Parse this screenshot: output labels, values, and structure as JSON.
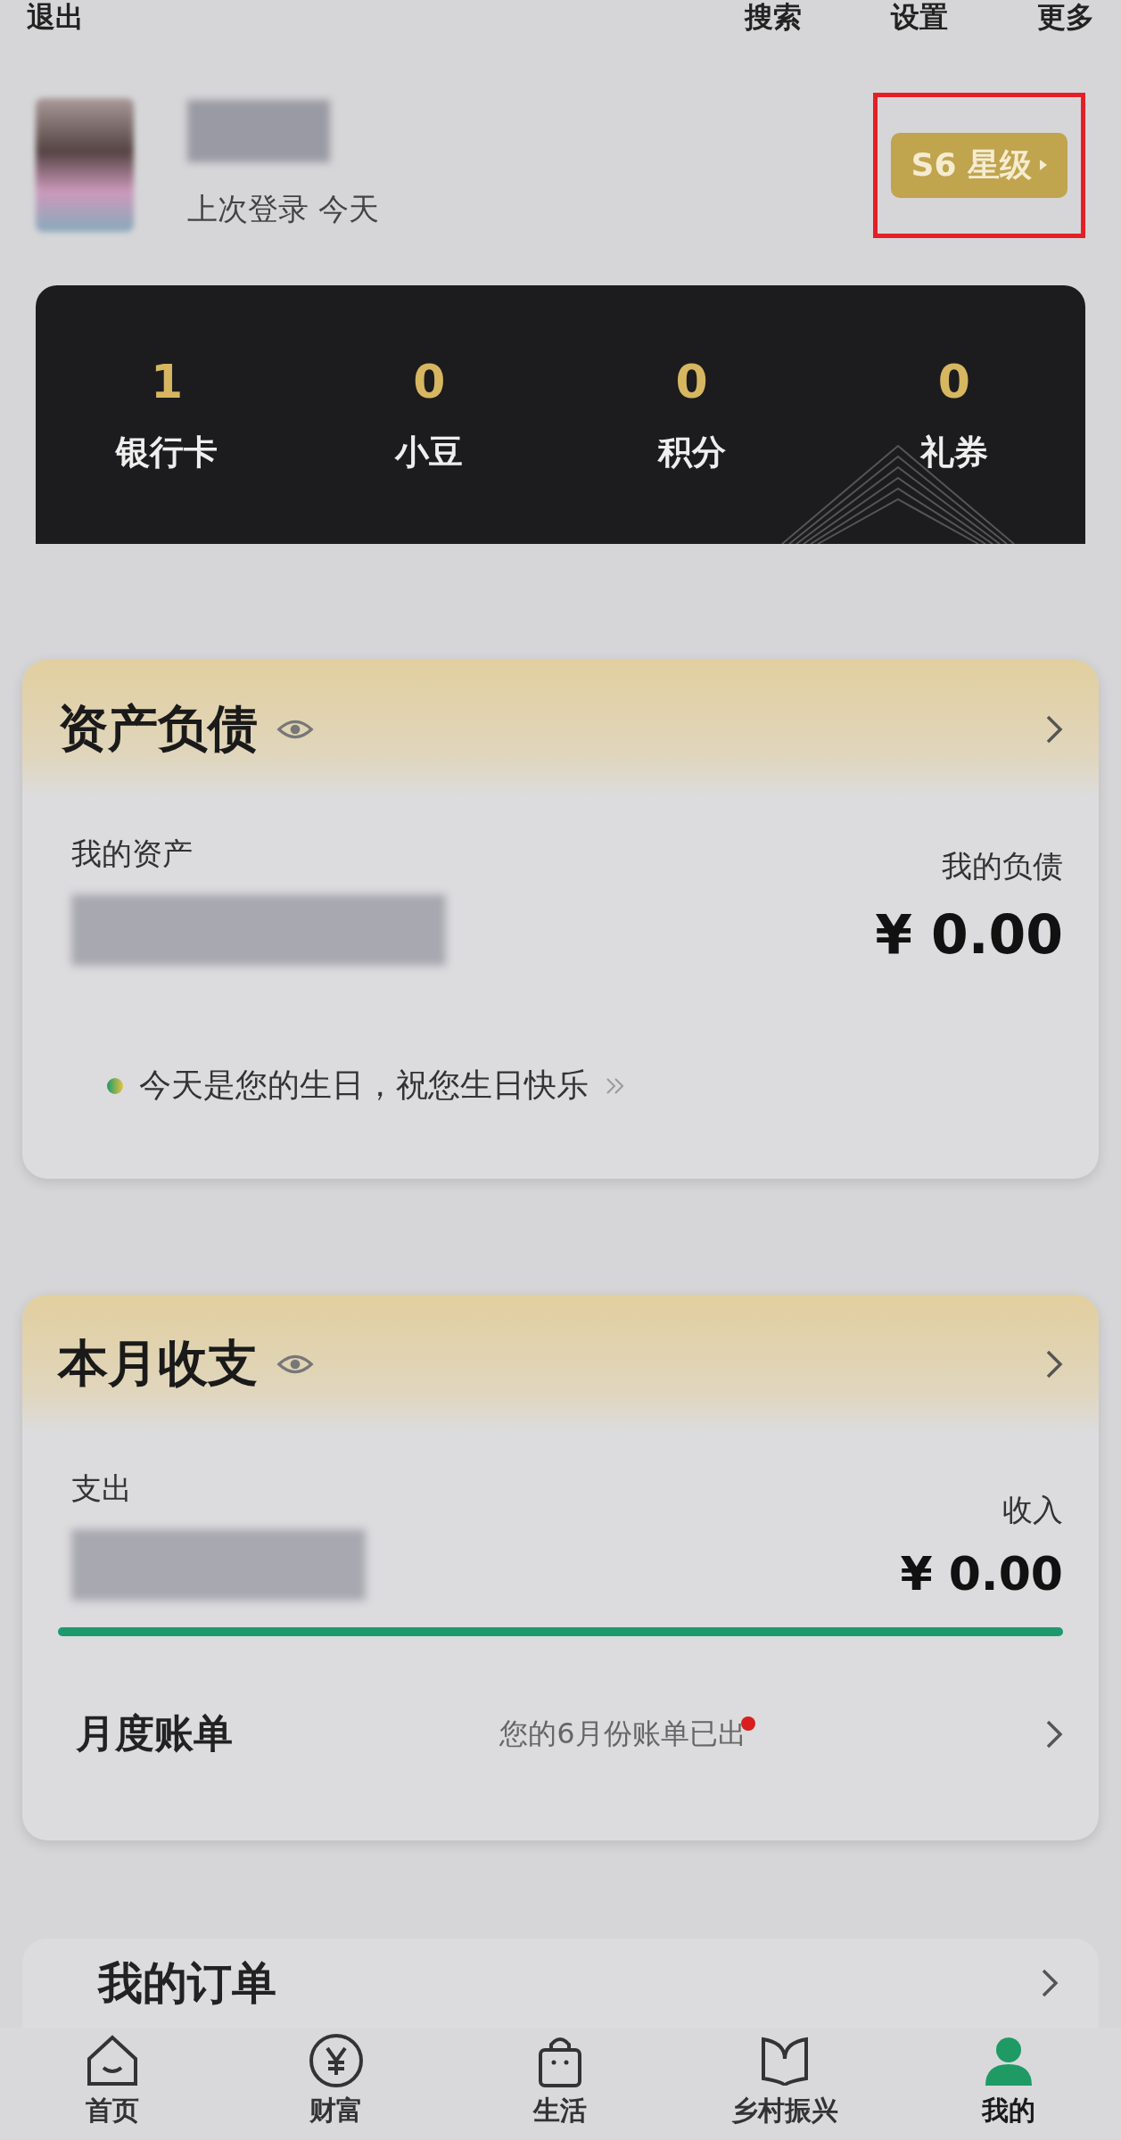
{
  "top_bar": {
    "left": "退出",
    "right": [
      "搜索",
      "设置",
      "更多"
    ]
  },
  "profile": {
    "last_login": "上次登录 今天",
    "level_badge": "S6 星级"
  },
  "stats": [
    {
      "value": "1",
      "label": "银行卡"
    },
    {
      "value": "0",
      "label": "小豆"
    },
    {
      "value": "0",
      "label": "积分"
    },
    {
      "value": "0",
      "label": "礼券"
    }
  ],
  "assets": {
    "title": "资产负债",
    "left_label": "我的资产",
    "right_label": "我的负债",
    "right_value": "¥ 0.00",
    "notice": "今天是您的生日，祝您生日快乐"
  },
  "monthly": {
    "title": "本月收支",
    "left_label": "支出",
    "right_label": "收入",
    "right_value": "¥ 0.00",
    "level": 1,
    "bill_label": "月度账单",
    "bill_note": "您的6月份账单已出",
    "bill_unread": true
  },
  "orders": {
    "title": "我的订单"
  },
  "nav": [
    {
      "label": "首页",
      "selected": false
    },
    {
      "label": "财富",
      "selected": false
    },
    {
      "label": "生活",
      "selected": false
    },
    {
      "label": "乡村振兴",
      "selected": false
    },
    {
      "label": "我的",
      "selected": true
    }
  ]
}
